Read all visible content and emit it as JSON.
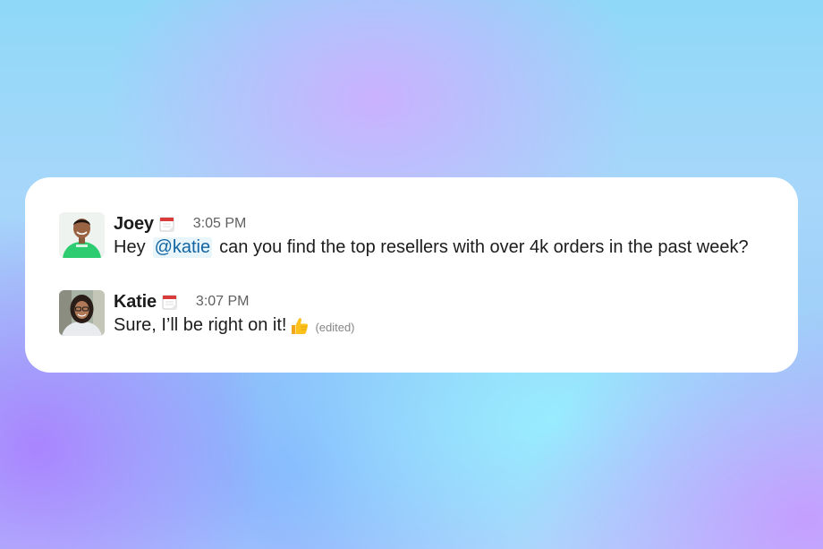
{
  "messages": [
    {
      "author": "Joey",
      "time": "3:05 PM",
      "text_before": "Hey",
      "mention": "@katie",
      "text_after": "can you find the top resellers with over 4k orders in the past week?",
      "status_icon": "calendar-icon"
    },
    {
      "author": "Katie",
      "time": "3:07 PM",
      "text": "Sure, I’ll be right on it!",
      "reaction_icon": "thumbs-up-icon",
      "edited_label": "(edited)",
      "status_icon": "calendar-icon"
    }
  ],
  "colors": {
    "mention_bg": "#e8f5fa",
    "mention_text": "#1264a3",
    "joey_shirt": "#2ecc71"
  }
}
